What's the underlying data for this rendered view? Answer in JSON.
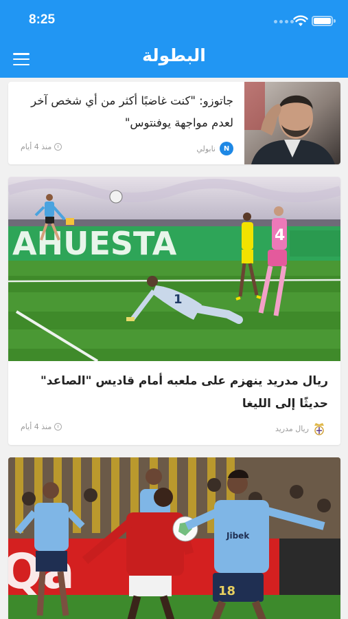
{
  "status_bar": {
    "time": "8:25"
  },
  "header": {
    "logo": "البطولة"
  },
  "articles": [
    {
      "title": "جاتوزو: \"كنت غاضبًا أكثر من أي شخص آخر لعدم مواجهة يوفنتوس\"",
      "source": "نابولي",
      "time": "منذ 4 أيام",
      "badge_icon": "napoli-crest-icon",
      "badge_color": "#1e88e5"
    },
    {
      "title": "ريال مدريد ينهزم على ملعبه أمام قاديس \"الصاعد\" حديثًا إلى الليغا",
      "source": "ريال مدريد",
      "time": "منذ 4 أيام",
      "badge_icon": "real-madrid-crest-icon"
    },
    {}
  ],
  "photo_text": {
    "banner": "AHUESTA",
    "jersey_1": "1",
    "jersey_2": "4",
    "jersey_3": "18"
  },
  "colors": {
    "header": "#2196f3",
    "pitch": "#3f8a2a",
    "ad_board": "#2ea558",
    "home_kit_red": "#d42020",
    "away_kit_blue": "#7fb6e6"
  }
}
